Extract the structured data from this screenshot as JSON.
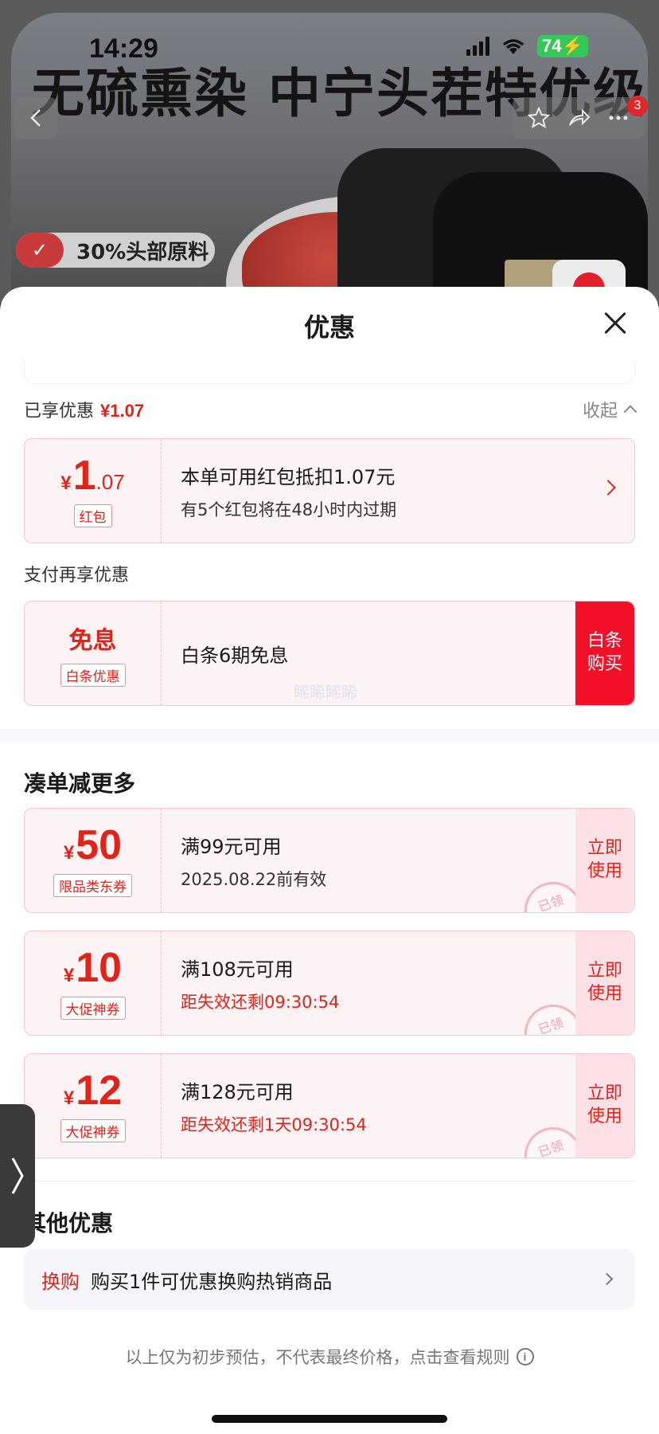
{
  "status_bar": {
    "time": "14:29",
    "battery": "74"
  },
  "background": {
    "product_title": "无硫熏染 中宁头茬特优级",
    "feature_label": "30%头部原料",
    "cart_badge": "3"
  },
  "sheet": {
    "title": "优惠",
    "enjoyed": {
      "label": "已享优惠",
      "amount": "¥1.07",
      "collapse_label": "收起"
    },
    "red_packet": {
      "yen": "¥",
      "int": "1",
      "dec": ".07",
      "tag": "红包",
      "main": "本单可用红包抵扣1.07元",
      "sub": "有5个红包将在48小时内过期"
    },
    "pay_label": "支付再享优惠",
    "baitiao": {
      "title": "免息",
      "tag": "白条优惠",
      "main": "白条6期免息",
      "button_line1": "白条",
      "button_line2": "购买",
      "watermark": "睎睎睎睎"
    },
    "more_title": "凑单减更多",
    "coupons": [
      {
        "yen": "¥",
        "value": "50",
        "tag": "限品类东券",
        "main": "满99元可用",
        "sub": "2025.08.22前有效",
        "sub_red": false,
        "btn1": "立即",
        "btn2": "使用",
        "stamp": "已领"
      },
      {
        "yen": "¥",
        "value": "10",
        "tag": "大促神券",
        "main": "满108元可用",
        "sub": "距失效还剩09:30:54",
        "sub_red": true,
        "btn1": "立即",
        "btn2": "使用",
        "stamp": "已领"
      },
      {
        "yen": "¥",
        "value": "12",
        "tag": "大促神券",
        "main": "满128元可用",
        "sub": "距失效还剩1天09:30:54",
        "sub_red": true,
        "btn1": "立即",
        "btn2": "使用",
        "stamp": "已领"
      }
    ],
    "other_title": "其他优惠",
    "other": {
      "tag": "换购",
      "text": "购买1件可优惠换购热销商品"
    },
    "footnote": "以上仅为初步预估，不代表最终价格，点击查看规则",
    "info_icon_glyph": "i"
  },
  "colors": {
    "accent_red": "#e2231a",
    "button_red": "#f5102a",
    "coupon_bg": "#fdf2f4"
  }
}
